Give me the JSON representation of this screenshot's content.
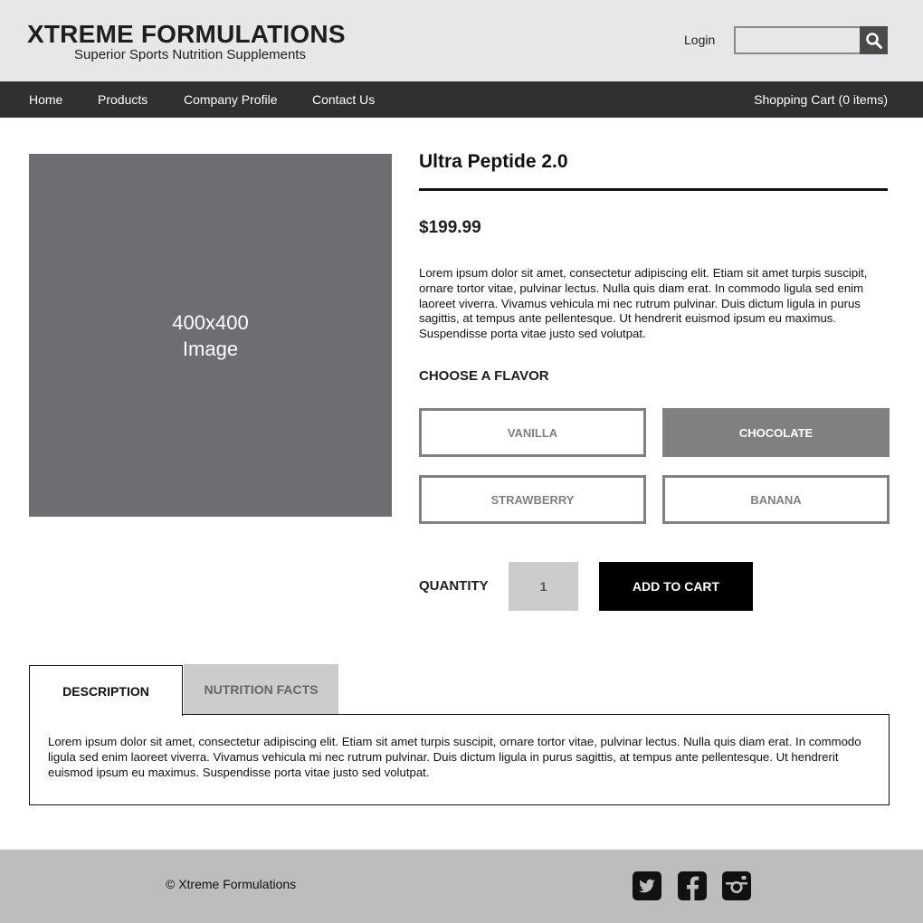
{
  "header": {
    "logo_title": "XTREME FORMULATIONS",
    "logo_subtitle": "Superior Sports Nutrition Supplements",
    "login_label": "Login",
    "search_value": "",
    "search_icon": "search-icon"
  },
  "nav": {
    "items": [
      {
        "label": "Home"
      },
      {
        "label": "Products"
      },
      {
        "label": "Company Profile"
      },
      {
        "label": "Contact Us"
      }
    ],
    "cart_label": "Shopping Cart (0 items)"
  },
  "product": {
    "image_line1": "400x400",
    "image_line2": "Image",
    "title": "Ultra Peptide 2.0",
    "price": "$199.99",
    "summary": "Lorem ipsum dolor sit amet, consectetur adipiscing elit. Etiam sit amet turpis sus­cipit, ornare tortor vitae, pulvinar lectus. Nulla quis diam erat. In commodo ligula sed enim laoreet viverra. Vivamus vehicula mi nec rutrum pulvinar. Duis dictum ligula in purus sagittis, at tempus ante pellentesque. Ut hendrerit euismod ipsum eu maximus. Suspendisse porta vitae justo sed volutpat.",
    "flavor_heading": "CHOOSE A FLAVOR",
    "flavors": [
      {
        "label": "VANILLA",
        "selected": false
      },
      {
        "label": "CHOCOLATE",
        "selected": true
      },
      {
        "label": "STRAWBERRY",
        "selected": false
      },
      {
        "label": "BANANA",
        "selected": false
      }
    ],
    "quantity_label": "QUANTITY",
    "quantity_value": "1",
    "add_to_cart_label": "ADD TO CART"
  },
  "tabs": {
    "items": [
      {
        "label": "DESCRIPTION",
        "active": true
      },
      {
        "label": "NUTRITION FACTS",
        "active": false
      }
    ],
    "description_text": "Lorem ipsum dolor sit amet, consectetur adipiscing elit. Etiam sit amet turpis suscipit, ornare tortor vitae, pulvinar lectus. Nulla quis diam erat. In commodo ligula sed enim laoreet viverra. Vivamus vehicula mi nec rutrum pulvinar. Duis dictum ligula in purus sagittis, at tempus ante pellen­tesque. Ut hendrerit euismod ipsum eu maximus. Suspendisse porta vitae justo sed volutpat."
  },
  "footer": {
    "copyright": "© Xtreme Formulations",
    "social_icons": [
      "twitter-icon",
      "facebook-icon",
      "instagram-icon"
    ]
  },
  "colors": {
    "header_bg": "#e6e7e9",
    "nav_bg": "#303030",
    "image_placeholder": "#6d6e71",
    "flavor_border": "#808080",
    "quantity_bg": "#cccccc",
    "cart_button_bg": "#000000",
    "footer_bg": "#bcbdbf"
  }
}
